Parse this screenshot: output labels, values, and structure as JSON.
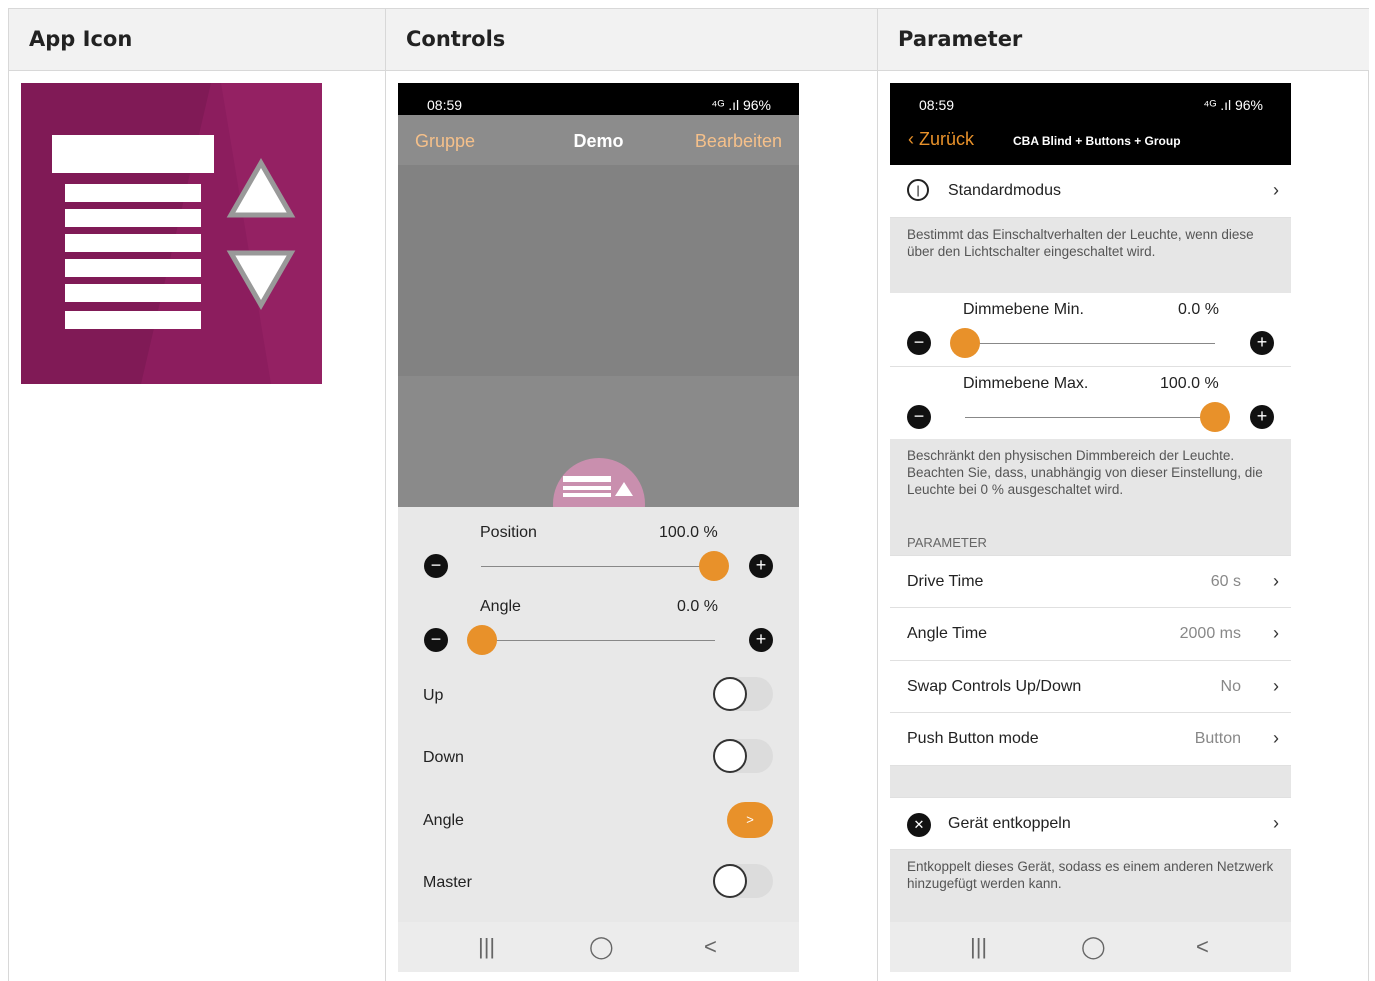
{
  "columns": {
    "app_icon": "App Icon",
    "controls": "Controls",
    "parameter": "Parameter"
  },
  "controls_screen": {
    "status_time": "08:59",
    "status_right": "⁴ᴳ .ıl 96%",
    "header": {
      "left": "Gruppe",
      "title": "Demo",
      "right": "Bearbeiten"
    },
    "position": {
      "label": "Position",
      "value": "100.0 %",
      "level": 1.0
    },
    "angle": {
      "label": "Angle",
      "value": "0.0 %",
      "level": 0.0
    },
    "switches": [
      {
        "label": "Up",
        "on": false
      },
      {
        "label": "Down",
        "on": false
      },
      {
        "label": "Angle",
        "button": ">"
      },
      {
        "label": "Master",
        "on": false
      }
    ],
    "nav": [
      "|||",
      "◯",
      "<"
    ]
  },
  "parameter_screen": {
    "status_time": "08:59",
    "status_right": "⁴ᴳ .ıl 96%",
    "back": "Zurück",
    "title": "CBA Blind + Buttons + Group",
    "standardmodus": "Standardmodus",
    "desc1": "Bestimmt das Einschaltverhalten der Leuchte, wenn diese über den Lichtschalter eingeschaltet wird.",
    "dim_min": {
      "label": "Dimmebene Min.",
      "value": "0.0 %",
      "level": 0.0
    },
    "dim_max": {
      "label": "Dimmebene Max.",
      "value": "100.0 %",
      "level": 1.0
    },
    "desc2": "Beschränkt den physischen Dimmbereich der Leuchte. Beachten Sie, dass, unabhängig von dieser Einstellung, die Leuchte bei 0 % ausgeschaltet wird.",
    "section": "PARAMETER",
    "params": [
      {
        "label": "Drive Time",
        "value": "60 s"
      },
      {
        "label": "Angle Time",
        "value": "2000 ms"
      },
      {
        "label": "Swap Controls Up/Down",
        "value": "No"
      },
      {
        "label": "Push Button mode",
        "value": "Button"
      }
    ],
    "unpair": "Gerät entkoppeln",
    "desc3": "Entkoppelt dieses Gerät, sodass es einem anderen Netzwerk hinzugefügt werden kann.",
    "nav": [
      "|||",
      "◯",
      "<"
    ]
  },
  "colors": {
    "accent": "#e8912a",
    "icon_bg": "#8c1d5e",
    "header_text": "#f5c08a"
  }
}
